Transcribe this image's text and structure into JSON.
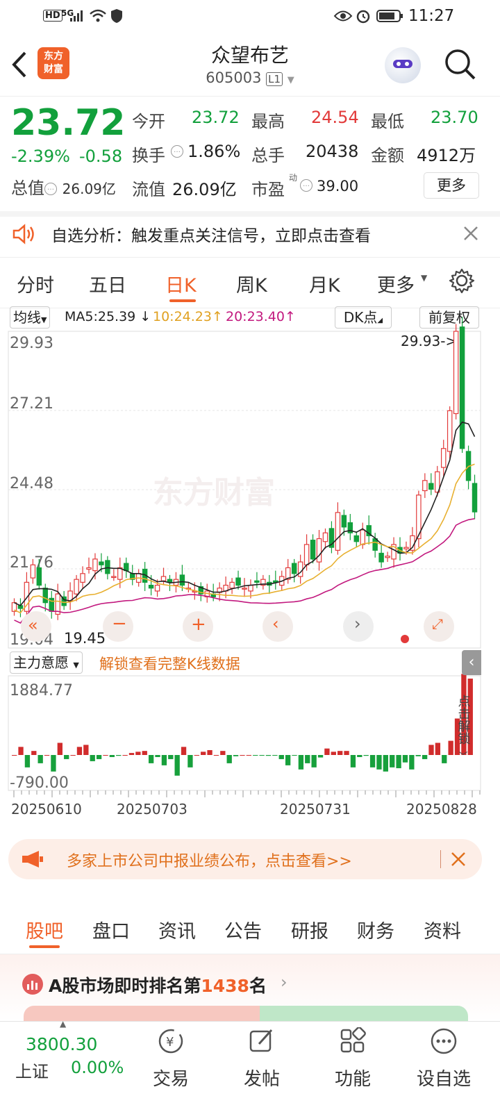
{
  "status": {
    "time": "11:27",
    "signal": "5G",
    "hd": "HD"
  },
  "nav": {
    "title": "众望布艺",
    "code": "605003",
    "level": "L1",
    "logo_line1": "东方",
    "logo_line2": "财富"
  },
  "quote": {
    "price": "23.72",
    "pct": "-2.39%",
    "chg": "-0.58",
    "open_label": "今开",
    "open": "23.72",
    "high_label": "最高",
    "high": "24.54",
    "low_label": "最低",
    "low": "23.70",
    "turnover_label": "换手",
    "turnover": "1.86%",
    "volume_label": "总手",
    "volume": "20438",
    "amount_label": "金额",
    "amount": "4912万",
    "mktcap_label": "总值",
    "mktcap": "26.09亿",
    "float_label": "流值",
    "float": "26.09亿",
    "pe_label": "市盈",
    "pe_sup": "动",
    "pe": "39.00",
    "more": "更多"
  },
  "alert": {
    "text": "自选分析：触发重点关注信号，立即点击查看"
  },
  "tabs": [
    "分时",
    "五日",
    "日K",
    "周K",
    "月K",
    "更多"
  ],
  "active_tab": "日K",
  "chart_toolbar": {
    "ma_select": "均线",
    "ma5": "MA5:25.39",
    "ma10": "10:24.23",
    "ma20": "20:23.40",
    "dk": "DK点",
    "adjust": "前复权"
  },
  "chart_data": {
    "type": "candlestick",
    "y_labels": [
      "29.93",
      "27.21",
      "24.48",
      "21.76",
      "19.04"
    ],
    "high_marker": "29.93->",
    "low_marker": "19.45",
    "x_labels": [
      "20250610",
      "20250703",
      "20250731",
      "20250828"
    ],
    "sub_indicator": "主力意愿",
    "sub_y_labels": [
      "1884.77",
      "-790.00"
    ],
    "unlock_text": "解锁查看完整K线数据",
    "unlock_side": "点击解锁",
    "watermark": "东方财富"
  },
  "banner": {
    "text": "多家上市公司中报业绩公布，点击查看>>"
  },
  "bottom_tabs": [
    "股吧",
    "盘口",
    "资讯",
    "公告",
    "研报",
    "财务",
    "资料"
  ],
  "rank": {
    "prefix": "A股市场即时排名第",
    "num": "1438",
    "suffix": "名"
  },
  "footer": {
    "index_value": "3800.30",
    "index_name": "上证",
    "index_pct": "0.00%",
    "items": [
      "交易",
      "发帖",
      "功能",
      "设自选"
    ]
  }
}
